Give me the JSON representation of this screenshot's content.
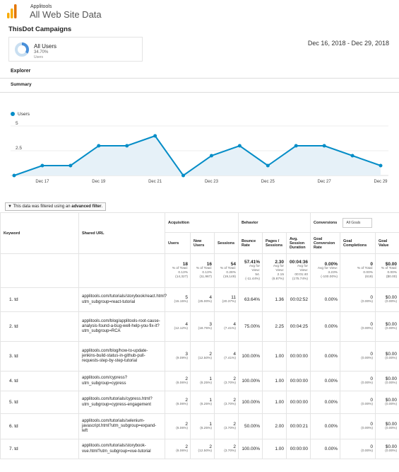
{
  "header": {
    "org": "Applitools",
    "property": "All Web Site Data"
  },
  "campaign_title": "ThisDot Campaigns",
  "segment": {
    "name": "All Users",
    "percent": "34.70%",
    "sub": "Users"
  },
  "date_range": "Dec 16, 2018 - Dec 29, 2018",
  "tabs": {
    "explorer": "Explorer",
    "summary": "Summary"
  },
  "chart_data": {
    "type": "area",
    "series": [
      {
        "name": "Users",
        "values": [
          0,
          1,
          1,
          3,
          3,
          4,
          0,
          2,
          3,
          1,
          3,
          3,
          2,
          1
        ]
      }
    ],
    "x": [
      "Dec 16",
      "Dec 17",
      "Dec 18",
      "Dec 19",
      "Dec 20",
      "Dec 21",
      "Dec 22",
      "Dec 23",
      "Dec 24",
      "Dec 25",
      "Dec 26",
      "Dec 27",
      "Dec 28",
      "Dec 29"
    ],
    "x_tick_labels": [
      "Dec 17",
      "Dec 19",
      "Dec 21",
      "Dec 23",
      "Dec 25",
      "Dec 27",
      "Dec 29"
    ],
    "y_tick_labels": [
      "5",
      "2.5"
    ],
    "ylim": [
      0,
      5
    ],
    "color": "#058dc7"
  },
  "filter": {
    "prefix": "This data was filtered using an",
    "link": "advanced filter",
    "suffix": "."
  },
  "table": {
    "headers": {
      "keyword": "Keyword",
      "shared_url": "Shared URL",
      "acquisition": "Acquisition",
      "behavior": "Behavior",
      "conversions": "Conversions",
      "goal_select": "All Goals",
      "users": "Users",
      "new_users": "New Users",
      "sessions": "Sessions",
      "bounce": "Bounce Rate",
      "pages": "Pages / Sessions",
      "duration": "Avg. Session Duration",
      "conv_rate": "Goal Conversion Rate",
      "completions": "Goal Completions",
      "value": "Goal Value"
    },
    "totals": {
      "users": "18",
      "users_sub1": "% of Total:",
      "users_sub2": "0.13%",
      "users_sub3": "(14,327)",
      "new_users": "16",
      "new_sub1": "% of Total:",
      "new_sub2": "0.13%",
      "new_sub3": "(11,987)",
      "sessions": "54",
      "sess_sub1": "% of Total:",
      "sess_sub2": "0.28%",
      "sess_sub3": "(19,149)",
      "bounce": "57.41%",
      "bounce_sub1": "Avg for View:",
      "bounce_sub2": "54.",
      "bounce_sub3": "(-11.44%)",
      "pages": "2.30",
      "pages_sub1": "Avg for View:",
      "pages_sub2": "2.15",
      "pages_sub3": "(6.87%)",
      "duration": "00:04:36",
      "dur_sub1": "Avg for View:",
      "dur_sub2": "00:01:40",
      "dur_sub3": "(175.74%)",
      "conv": "0.00%",
      "conv_sub1": "Avg for View:",
      "conv_sub2": "3.23%",
      "conv_sub3": "(-100.00%)",
      "comp": "0",
      "comp_sub1": "% of Total:",
      "comp_sub2": "0.00%",
      "comp_sub3": "(619)",
      "value": "$0.00",
      "value_sub1": "% of Total:",
      "value_sub2": "0.00%",
      "value_sub3": "($0.00)"
    },
    "rows": [
      {
        "kw": "1. td",
        "url": "applitools.com/tutorials/storybook/react.html?utm_subgroup=react-tutorial",
        "users": "5",
        "users_pct": "(15.15%)",
        "new": "4",
        "new_pct": "(25.00%)",
        "sess": "11",
        "sess_pct": "(20.37%)",
        "bounce": "63.64%",
        "pages": "1.36",
        "dur": "00:02:52",
        "conv": "0.00%",
        "comp": "0",
        "comp_pct": "(0.00%)",
        "val": "$0.00",
        "val_pct": "(0.00%)"
      },
      {
        "kw": "2. td",
        "url": "applitools.com/blog/applitools-root-cause-analysis-found-a-bug-well-help-you-fix-it?utm_subgroup=RCA",
        "users": "4",
        "users_pct": "(12.12%)",
        "new": "3",
        "new_pct": "(18.75%)",
        "sess": "4",
        "sess_pct": "(7.41%)",
        "bounce": "75.00%",
        "pages": "2.25",
        "dur": "00:04:25",
        "conv": "0.00%",
        "comp": "0",
        "comp_pct": "(0.00%)",
        "val": "$0.00",
        "val_pct": "(0.00%)"
      },
      {
        "kw": "3. td",
        "url": "applitools.com/blog/how-to-update-jenkins-build-status-in-github-pull-requests-step-by-step-tutorial",
        "users": "3",
        "users_pct": "(9.09%)",
        "new": "2",
        "new_pct": "(12.50%)",
        "sess": "4",
        "sess_pct": "(7.41%)",
        "bounce": "100.00%",
        "pages": "1.00",
        "dur": "00:00:00",
        "conv": "0.00%",
        "comp": "0",
        "comp_pct": "(0.00%)",
        "val": "$0.00",
        "val_pct": "(0.00%)"
      },
      {
        "kw": "4. td",
        "url": "applitools.com/cypress?utm_subgroup=cypress",
        "users": "2",
        "users_pct": "(6.06%)",
        "new": "1",
        "new_pct": "(6.25%)",
        "sess": "2",
        "sess_pct": "(3.70%)",
        "bounce": "100.00%",
        "pages": "1.00",
        "dur": "00:00:00",
        "conv": "0.00%",
        "comp": "0",
        "comp_pct": "(0.00%)",
        "val": "$0.00",
        "val_pct": "(0.00%)"
      },
      {
        "kw": "5. td",
        "url": "applitools.com/tutorials/cypress.html?utm_subgroup=cypress-engagement",
        "users": "2",
        "users_pct": "(6.06%)",
        "new": "1",
        "new_pct": "(6.25%)",
        "sess": "2",
        "sess_pct": "(3.70%)",
        "bounce": "100.00%",
        "pages": "1.00",
        "dur": "00:00:00",
        "conv": "0.00%",
        "comp": "0",
        "comp_pct": "(0.00%)",
        "val": "$0.00",
        "val_pct": "(0.00%)"
      },
      {
        "kw": "6. td",
        "url": "applitools.com/tutorials/selenium-javascript.html?utm_subgroup=expand-left",
        "users": "2",
        "users_pct": "(6.06%)",
        "new": "1",
        "new_pct": "(6.25%)",
        "sess": "2",
        "sess_pct": "(3.70%)",
        "bounce": "50.00%",
        "pages": "2.00",
        "dur": "00:00:21",
        "conv": "0.00%",
        "comp": "0",
        "comp_pct": "(0.00%)",
        "val": "$0.00",
        "val_pct": "(0.00%)"
      },
      {
        "kw": "7. td",
        "url": "applitools.com/tutorials/storybook-vue.html?utm_subgroup=vue-tutorial",
        "users": "2",
        "users_pct": "(6.06%)",
        "new": "2",
        "new_pct": "(12.50%)",
        "sess": "2",
        "sess_pct": "(3.70%)",
        "bounce": "100.00%",
        "pages": "1.00",
        "dur": "00:00:00",
        "conv": "0.00%",
        "comp": "0",
        "comp_pct": "(0.00%)",
        "val": "$0.00",
        "val_pct": "(0.00%)"
      }
    ]
  }
}
